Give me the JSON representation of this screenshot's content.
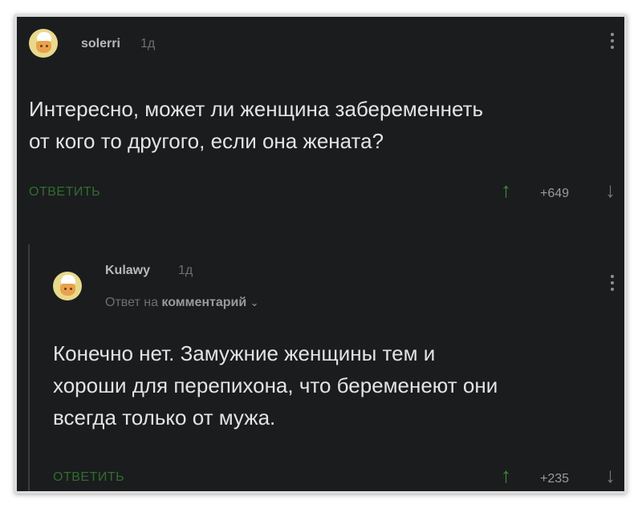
{
  "comments": [
    {
      "username": "solerri",
      "time": "1д",
      "text_lines": [
        "Интересно, может ли женщина забеременнеть",
        "от кого то другого, если она жената?"
      ],
      "reply_label": "ОТВЕТИТЬ",
      "rating": "+649",
      "up_icon": "arrow-up-icon",
      "down_icon": "arrow-down-icon"
    },
    {
      "username": "Kulawy",
      "time": "1д",
      "reply_to_prefix": "Ответ на",
      "reply_to_target": "комментарий",
      "text_lines": [
        "Конечно нет. Замужние женщины тем и",
        "хороши для перепихона, что беременеют они",
        "всегда только от мужа."
      ],
      "reply_label": "ОТВЕТИТЬ",
      "rating": "+235"
    }
  ],
  "colors": {
    "background": "#1b1c1e",
    "reply": "#2f6e2d",
    "upvote": "#3f8f37"
  }
}
